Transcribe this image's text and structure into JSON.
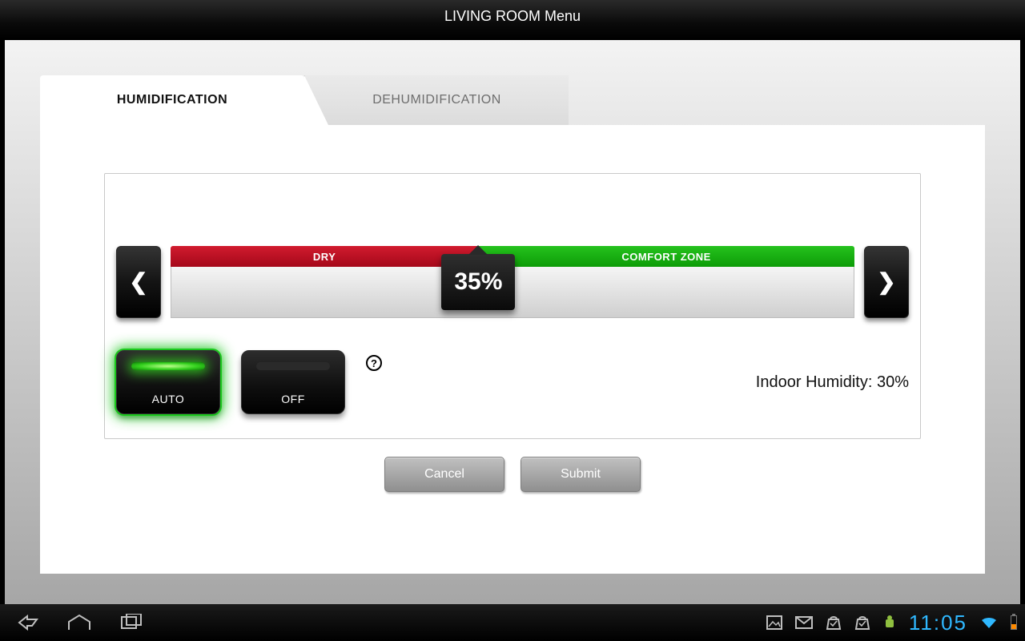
{
  "header": {
    "title": "LIVING ROOM Menu"
  },
  "tabs": [
    {
      "label": "HUMIDIFICATION",
      "active": true
    },
    {
      "label": "DEHUMIDIFICATION",
      "active": false
    }
  ],
  "slider": {
    "zone_dry_label": "DRY",
    "zone_comfort_label": "COMFORT ZONE",
    "value_display": "35%",
    "value_percent": 35,
    "split_percent": 45
  },
  "modes": {
    "auto_label": "AUTO",
    "off_label": "OFF",
    "active": "AUTO"
  },
  "status": {
    "indoor_humidity_label": "Indoor Humidity: 30%",
    "indoor_humidity_value": 30
  },
  "actions": {
    "cancel_label": "Cancel",
    "submit_label": "Submit"
  },
  "system_bar": {
    "time": "11:05"
  }
}
